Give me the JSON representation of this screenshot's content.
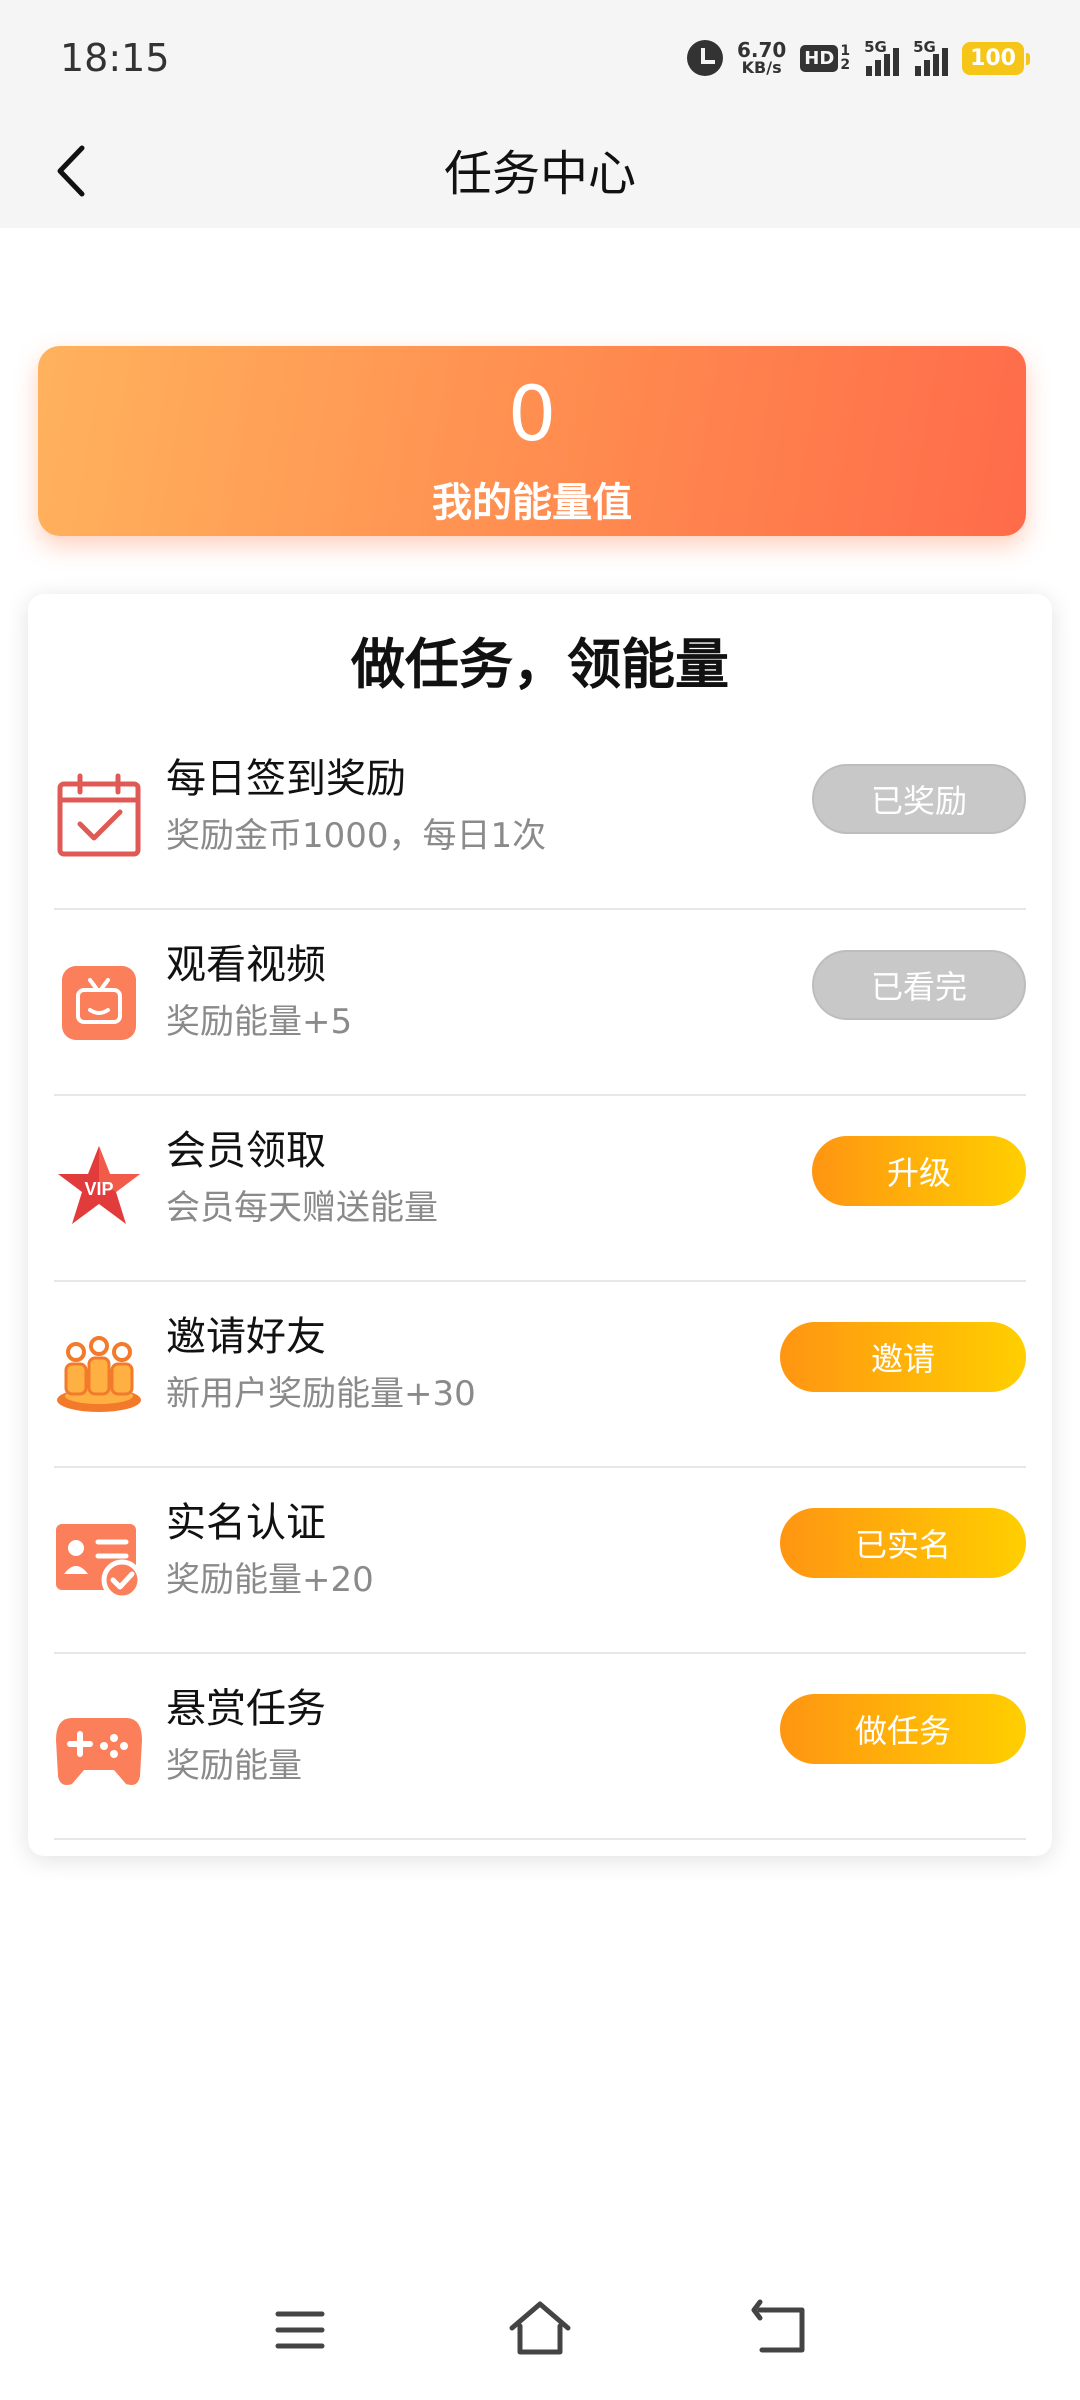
{
  "status_bar": {
    "time": "18:15",
    "net_speed_value": "6.70",
    "net_speed_unit": "KB/s",
    "hd_label": "HD",
    "hd_sub_top": "1",
    "hd_sub_bottom": "2",
    "sim1_label": "5G",
    "sim2_label": "5G",
    "battery": "100",
    "icons": [
      "alarm-icon",
      "hd-icon",
      "signal-icon",
      "signal-icon",
      "battery-icon"
    ]
  },
  "nav": {
    "title": "任务中心",
    "back_icon": "chevron-left-icon"
  },
  "energy": {
    "value": "0",
    "label": "我的能量值"
  },
  "tasks_section": {
    "heading": "做任务，领能量",
    "tasks": [
      {
        "title": "每日签到奖励",
        "desc": "奖励金币1000，每日1次",
        "button": "已奖励",
        "icon": "calendar-check-icon"
      },
      {
        "title": "观看视频",
        "desc": "奖励能量+5",
        "button": "已看完",
        "icon": "tv-icon"
      },
      {
        "title": "会员领取",
        "desc": "会员每天赠送能量",
        "button": "升级",
        "icon": "vip-star-icon"
      },
      {
        "title": "邀请好友",
        "desc": "新用户奖励能量+30",
        "button": "邀请",
        "icon": "friends-icon"
      },
      {
        "title": "实名认证",
        "desc": "奖励能量+20",
        "button": "已实名",
        "icon": "id-card-icon"
      },
      {
        "title": "悬赏任务",
        "desc": "奖励能量",
        "button": "做任务",
        "icon": "gamepad-icon"
      }
    ]
  },
  "colors": {
    "energy_gradient_start": "#ffb25d",
    "energy_gradient_end": "#ff6b4a",
    "button_active_start": "#ff9512",
    "button_active_end": "#ffcf00",
    "button_done": "#c8c8c8"
  },
  "system_nav": {
    "icons": [
      "menu-icon",
      "home-icon",
      "back-icon"
    ]
  }
}
